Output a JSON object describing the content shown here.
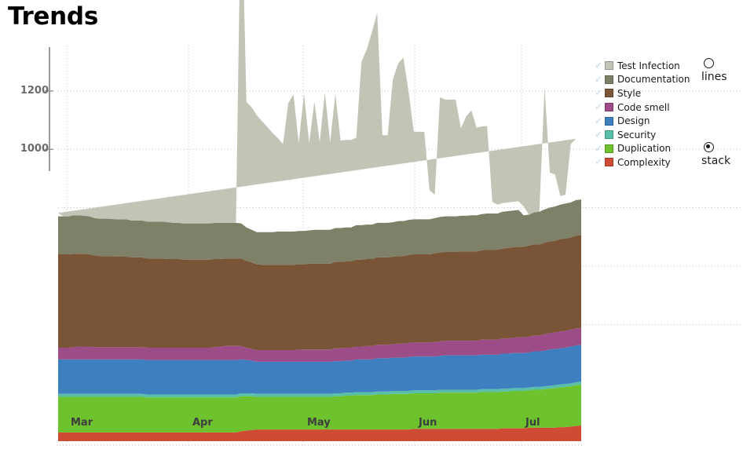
{
  "page": {
    "title": "Trends"
  },
  "chart_data": {
    "type": "area",
    "title": "Trends",
    "stacked": true,
    "xlabel": "",
    "ylabel": "",
    "grid": true,
    "legend_position": "right",
    "ylim": [
      0,
      1350
    ],
    "yticks": [
      1000,
      1200
    ],
    "ytick_labels": [
      "1000",
      "1200"
    ],
    "gridline_values": [
      400,
      600,
      800,
      1000,
      1200
    ],
    "categories": [
      "Mar",
      "Apr",
      "May",
      "Jun",
      "Jul"
    ],
    "xtick_labels": [
      "Mar",
      "Apr",
      "May",
      "Jun",
      "Jul"
    ],
    "x": [
      0,
      1,
      2,
      3,
      4,
      5,
      6,
      7,
      8,
      9,
      10,
      11,
      12,
      13,
      14,
      15,
      16,
      17,
      18,
      19,
      20,
      21,
      22,
      23,
      24,
      25,
      26,
      27,
      28,
      29,
      30,
      31,
      32,
      33,
      34,
      35,
      36,
      37,
      38,
      39,
      40,
      41,
      42,
      43,
      44,
      45,
      46,
      47,
      48,
      49,
      50,
      51,
      52,
      53,
      54,
      55,
      56,
      57,
      58,
      59,
      60,
      61,
      62,
      63,
      64,
      65,
      66,
      67,
      68,
      69,
      70,
      71,
      72,
      73,
      74,
      75,
      76,
      77,
      78,
      79,
      80,
      81,
      82,
      83,
      84,
      85,
      86,
      87,
      88,
      89,
      90,
      91,
      92,
      93,
      94,
      95,
      96,
      97,
      98,
      99,
      100
    ],
    "series": [
      {
        "name": "Complexity",
        "color": "#cf4b33",
        "values": [
          30,
          30,
          30,
          30,
          30,
          30,
          30,
          30,
          30,
          30,
          30,
          30,
          30,
          30,
          30,
          30,
          30,
          30,
          30,
          30,
          30,
          30,
          30,
          30,
          30,
          30,
          30,
          30,
          30,
          30,
          30,
          30,
          30,
          30,
          30,
          34,
          36,
          38,
          40,
          40,
          40,
          40,
          40,
          40,
          40,
          40,
          40,
          40,
          40,
          40,
          40,
          40,
          40,
          40,
          40,
          40,
          40,
          40,
          40,
          40,
          40,
          40,
          40,
          40,
          40,
          40,
          40,
          40,
          42,
          42,
          42,
          42,
          42,
          42,
          42,
          42,
          42,
          42,
          42,
          42,
          42,
          42,
          42,
          42,
          42,
          44,
          44,
          44,
          44,
          44,
          46,
          46,
          46,
          46,
          46,
          46,
          48,
          48,
          50,
          52,
          54
        ]
      },
      {
        "name": "Duplication",
        "color": "#6ec22e",
        "values": [
          122,
          122,
          122,
          122,
          122,
          122,
          122,
          122,
          122,
          122,
          122,
          122,
          122,
          122,
          122,
          122,
          122,
          120,
          120,
          120,
          120,
          120,
          120,
          120,
          120,
          120,
          120,
          120,
          120,
          120,
          120,
          120,
          120,
          120,
          120,
          120,
          118,
          116,
          112,
          112,
          112,
          112,
          112,
          112,
          112,
          112,
          112,
          112,
          112,
          112,
          112,
          112,
          112,
          114,
          114,
          116,
          116,
          118,
          118,
          118,
          118,
          120,
          120,
          120,
          122,
          122,
          122,
          122,
          122,
          122,
          122,
          122,
          122,
          124,
          124,
          124,
          124,
          124,
          124,
          124,
          124,
          126,
          126,
          126,
          126,
          126,
          126,
          128,
          128,
          128,
          128,
          130,
          130,
          132,
          134,
          136,
          136,
          138,
          138,
          140,
          140
        ]
      },
      {
        "name": "Security",
        "color": "#59bfa8",
        "values": [
          10,
          10,
          10,
          10,
          10,
          10,
          10,
          10,
          10,
          10,
          10,
          10,
          10,
          10,
          10,
          10,
          10,
          10,
          10,
          10,
          10,
          10,
          10,
          10,
          10,
          10,
          10,
          10,
          10,
          10,
          10,
          10,
          10,
          10,
          10,
          10,
          10,
          10,
          10,
          10,
          10,
          10,
          10,
          10,
          10,
          10,
          10,
          10,
          10,
          10,
          10,
          10,
          10,
          10,
          10,
          10,
          10,
          10,
          10,
          10,
          10,
          10,
          10,
          10,
          10,
          10,
          10,
          10,
          10,
          10,
          10,
          10,
          10,
          10,
          10,
          10,
          10,
          10,
          10,
          10,
          10,
          10,
          10,
          10,
          10,
          10,
          10,
          10,
          10,
          10,
          10,
          10,
          10,
          10,
          10,
          10,
          10,
          10,
          10,
          10,
          10
        ]
      },
      {
        "name": "Design",
        "color": "#3e80bf",
        "values": [
          118,
          118,
          118,
          118,
          118,
          118,
          118,
          118,
          118,
          118,
          118,
          118,
          118,
          118,
          118,
          118,
          118,
          118,
          118,
          118,
          118,
          118,
          118,
          118,
          118,
          118,
          118,
          118,
          118,
          118,
          118,
          118,
          118,
          118,
          118,
          116,
          114,
          112,
          110,
          110,
          110,
          110,
          110,
          110,
          110,
          110,
          110,
          110,
          110,
          110,
          110,
          110,
          110,
          110,
          110,
          110,
          110,
          112,
          112,
          112,
          112,
          114,
          114,
          114,
          114,
          114,
          114,
          116,
          116,
          116,
          116,
          116,
          116,
          116,
          118,
          118,
          118,
          118,
          118,
          118,
          118,
          118,
          118,
          118,
          118,
          120,
          120,
          120,
          120,
          120,
          120,
          122,
          122,
          122,
          124,
          124,
          124,
          124,
          126,
          126,
          126
        ]
      },
      {
        "name": "Code smell",
        "color": "#9c4c87",
        "values": [
          40,
          40,
          40,
          42,
          44,
          44,
          44,
          42,
          42,
          42,
          42,
          42,
          42,
          42,
          42,
          42,
          42,
          42,
          42,
          42,
          42,
          42,
          42,
          42,
          42,
          42,
          42,
          42,
          42,
          42,
          44,
          46,
          48,
          48,
          48,
          46,
          42,
          40,
          40,
          40,
          40,
          40,
          40,
          40,
          40,
          40,
          42,
          42,
          42,
          42,
          42,
          42,
          42,
          44,
          44,
          44,
          44,
          44,
          44,
          46,
          46,
          46,
          46,
          46,
          46,
          48,
          48,
          48,
          48,
          48,
          48,
          48,
          50,
          50,
          50,
          50,
          50,
          50,
          50,
          50,
          50,
          52,
          52,
          52,
          52,
          52,
          52,
          52,
          54,
          54,
          54,
          54,
          54,
          56,
          56,
          56,
          58,
          58,
          58,
          58,
          58
        ]
      },
      {
        "name": "Style",
        "color": "#7a5437",
        "values": [
          320,
          320,
          320,
          320,
          318,
          318,
          316,
          314,
          312,
          312,
          312,
          310,
          310,
          310,
          308,
          308,
          308,
          306,
          306,
          306,
          306,
          304,
          304,
          304,
          302,
          302,
          302,
          302,
          302,
          302,
          302,
          300,
          300,
          300,
          300,
          300,
          298,
          296,
          294,
          292,
          292,
          292,
          292,
          292,
          292,
          292,
          292,
          292,
          294,
          294,
          294,
          294,
          294,
          296,
          296,
          296,
          296,
          298,
          298,
          298,
          298,
          300,
          300,
          300,
          300,
          300,
          300,
          302,
          302,
          302,
          302,
          302,
          304,
          304,
          304,
          304,
          304,
          306,
          306,
          306,
          306,
          306,
          308,
          308,
          308,
          308,
          310,
          310,
          310,
          310,
          312,
          312,
          312,
          314,
          314,
          314,
          316,
          316,
          316,
          318,
          318
        ]
      },
      {
        "name": "Documentation",
        "color": "#7e8168",
        "values": [
          130,
          130,
          130,
          132,
          132,
          130,
          130,
          128,
          128,
          128,
          128,
          128,
          128,
          128,
          126,
          126,
          126,
          126,
          126,
          126,
          126,
          126,
          124,
          124,
          124,
          124,
          124,
          124,
          124,
          124,
          124,
          124,
          122,
          122,
          122,
          120,
          114,
          112,
          110,
          112,
          112,
          112,
          114,
          114,
          114,
          114,
          114,
          114,
          114,
          116,
          116,
          116,
          116,
          116,
          116,
          116,
          116,
          118,
          118,
          118,
          118,
          118,
          118,
          118,
          118,
          120,
          120,
          120,
          120,
          120,
          120,
          120,
          120,
          122,
          122,
          122,
          122,
          122,
          122,
          124,
          124,
          124,
          124,
          124,
          124,
          126,
          126,
          126,
          126,
          108,
          106,
          110,
          112,
          114,
          116,
          118,
          118,
          120,
          120,
          122,
          122
        ]
      },
      {
        "name": "Test Infection",
        "color": "#c3c3b6",
        "values": [
          12,
          0,
          0,
          0,
          0,
          0,
          0,
          0,
          0,
          0,
          0,
          0,
          0,
          0,
          0,
          0,
          0,
          0,
          0,
          0,
          0,
          0,
          0,
          0,
          0,
          0,
          0,
          0,
          0,
          0,
          0,
          0,
          0,
          0,
          0,
          1180,
          430,
          420,
          400,
          380,
          360,
          340,
          320,
          300,
          440,
          470,
          300,
          470,
          300,
          440,
          300,
          470,
          300,
          460,
          300,
          300,
          300,
          300,
          560,
          600,
          660,
          720,
          300,
          300,
          490,
          540,
          560,
          440,
          300,
          300,
          300,
          100,
          80,
          410,
          400,
          400,
          400,
          300,
          340,
          360,
          300,
          300,
          300,
          40,
          30,
          30,
          30,
          30,
          30,
          30,
          0,
          0,
          0,
          420,
          120,
          110,
          30,
          30,
          200,
          210
        ]
      }
    ],
    "legend": [
      {
        "label": "Test Infection",
        "color": "#c3c3b6",
        "checked": true
      },
      {
        "label": "Documentation",
        "color": "#7e8168",
        "checked": true
      },
      {
        "label": "Style",
        "color": "#7a5437",
        "checked": true
      },
      {
        "label": "Code smell",
        "color": "#9c4c87",
        "checked": true
      },
      {
        "label": "Design",
        "color": "#3e80bf",
        "checked": true
      },
      {
        "label": "Security",
        "color": "#59bfa8",
        "checked": true
      },
      {
        "label": "Duplication",
        "color": "#6ec22e",
        "checked": true
      },
      {
        "label": "Complexity",
        "color": "#cf4b33",
        "checked": true
      }
    ],
    "check_glyph": "✓"
  },
  "mode_selector": {
    "options": [
      {
        "id": "lines",
        "label": "lines",
        "selected": false
      },
      {
        "id": "stack",
        "label": "stack",
        "selected": true
      }
    ]
  },
  "colors": {
    "grid": "#bdbdbd",
    "axis": "#9a9a9a",
    "ytick_text": "#6b6b6b",
    "xtick_text": "#3d3d3d",
    "check": "#bcd9f0"
  }
}
